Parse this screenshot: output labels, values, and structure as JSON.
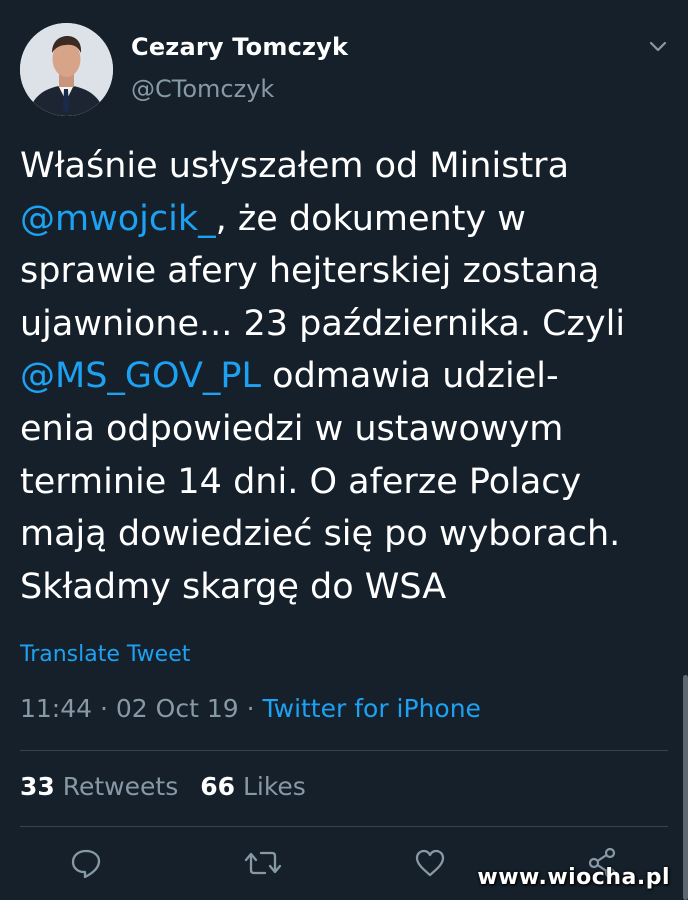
{
  "author": {
    "name": "Cezary Tomczyk",
    "handle": "@CTomczyk"
  },
  "tweet": {
    "lines": [
      {
        "pre": "Właśnie usłyszałem od Ministra",
        "mention": "",
        "post": ""
      },
      {
        "pre": "",
        "mention": "@mwojcik_",
        "post": ", że dokumenty w"
      },
      {
        "pre": "sprawie afery hejterskiej zostaną",
        "mention": "",
        "post": ""
      },
      {
        "pre": "ujawnione... 23 października. Czyli",
        "mention": "",
        "post": ""
      },
      {
        "pre": "",
        "mention": "@MS_GOV_PL",
        "post": " odmawia udziel-"
      },
      {
        "pre": "enia odpowiedzi w ustawowym",
        "mention": "",
        "post": ""
      },
      {
        "pre": "terminie 14 dni. O aferze Polacy",
        "mention": "",
        "post": ""
      },
      {
        "pre": "mają dowiedzieć się po wyborach.",
        "mention": "",
        "post": ""
      },
      {
        "pre": "Składmy skargę do WSA",
        "mention": "",
        "post": ""
      }
    ],
    "translate_label": "Translate Tweet",
    "time": "11:44",
    "date": "02 Oct 19",
    "separator": " · ",
    "source": "Twitter for iPhone"
  },
  "stats": {
    "retweets_count": "33",
    "retweets_label": "Retweets",
    "likes_count": "66",
    "likes_label": "Likes"
  },
  "icons": {
    "menu": "chevron-down-icon",
    "reply": "reply-icon",
    "retweet": "retweet-icon",
    "like": "heart-icon",
    "share": "share-icon"
  },
  "colors": {
    "background": "#15202b",
    "accent": "#1da1f2",
    "secondary_text": "#8899a6",
    "divider": "#38444d"
  },
  "watermark": "www.wiocha.pl"
}
